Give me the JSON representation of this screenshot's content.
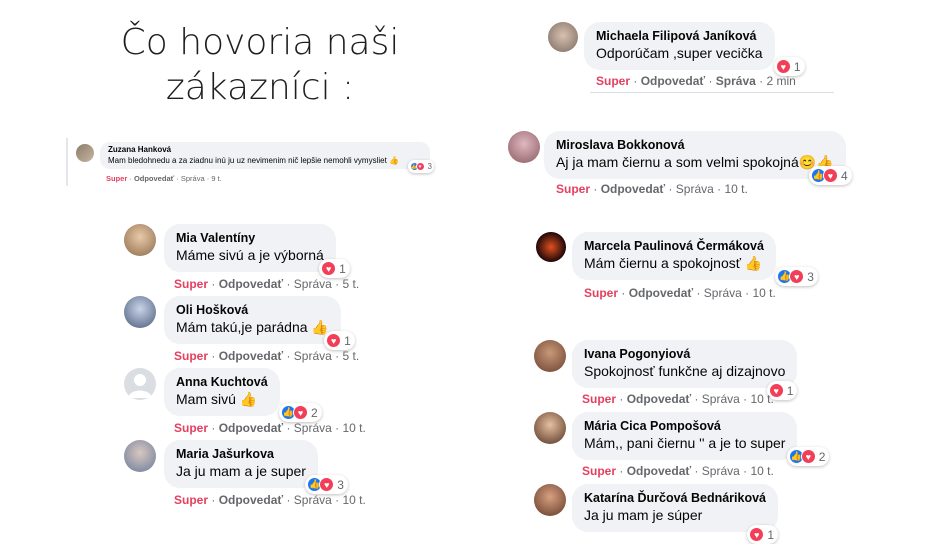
{
  "page_title": "Čo hovoria naši zákazníci :",
  "action_labels": {
    "super": "Super",
    "reply": "Odpovedať",
    "message": "Správa"
  },
  "mini_comment": {
    "name": "Zuzana Hanková",
    "text": "Mam bledohnedu a za ziadnu inú ju uz nevimenim nič lepšie nemohli vymysliet 👍",
    "count": "3",
    "time": "9 t."
  },
  "comments": [
    {
      "name": "Mia Valentíny",
      "text": "Máme sivú a je výborná",
      "count": "1",
      "time": "5 t.",
      "reactions": [
        "love"
      ]
    },
    {
      "name": "Oli Hošková",
      "text": "Mám takú,je parádna 👍",
      "count": "1",
      "time": "5 t.",
      "reactions": [
        "love"
      ]
    },
    {
      "name": "Anna Kuchtová",
      "text": "Mam sivú 👍",
      "count": "2",
      "time": "10 t.",
      "reactions": [
        "like",
        "love"
      ]
    },
    {
      "name": "Maria Jašurkova",
      "text": "Ja ju mam a je super",
      "count": "3",
      "time": "10 t.",
      "reactions": [
        "like",
        "love"
      ]
    },
    {
      "name": "Michaela Filipová Janíková",
      "text": "Odporúčam ,super vecička",
      "count": "1",
      "time": "2 min",
      "reactions": [
        "love"
      ]
    },
    {
      "name": "Miroslava Bokkonová",
      "text": "Aj ja mam čiernu a som velmi spokojná😊👍",
      "count": "4",
      "time": "10 t.",
      "reactions": [
        "like",
        "love"
      ]
    },
    {
      "name": "Marcela Paulinová Čermáková",
      "text": "Mám čiernu a spokojnosť 👍",
      "count": "3",
      "time": "10 t.",
      "reactions": [
        "like",
        "love"
      ]
    },
    {
      "name": "Ivana Pogonyiová",
      "text": "Spokojnosť funkčne aj dizajnovo",
      "count": "1",
      "time": "10 t.",
      "reactions": [
        "love"
      ]
    },
    {
      "name": "Mária Cica Pompošová",
      "text": "Mám,, pani čiernu '' a je to super",
      "count": "2",
      "time": "10 t.",
      "reactions": [
        "like",
        "love"
      ]
    },
    {
      "name": "Katarína Ďurčová Bednáriková",
      "text": "Ja ju mam je súper",
      "count": "1",
      "time": "",
      "reactions": [
        "love"
      ]
    }
  ],
  "colors": {
    "super": "#e4405f",
    "like": "#1877f2",
    "love": "#f33e58",
    "bubble": "#f0f2f5"
  }
}
